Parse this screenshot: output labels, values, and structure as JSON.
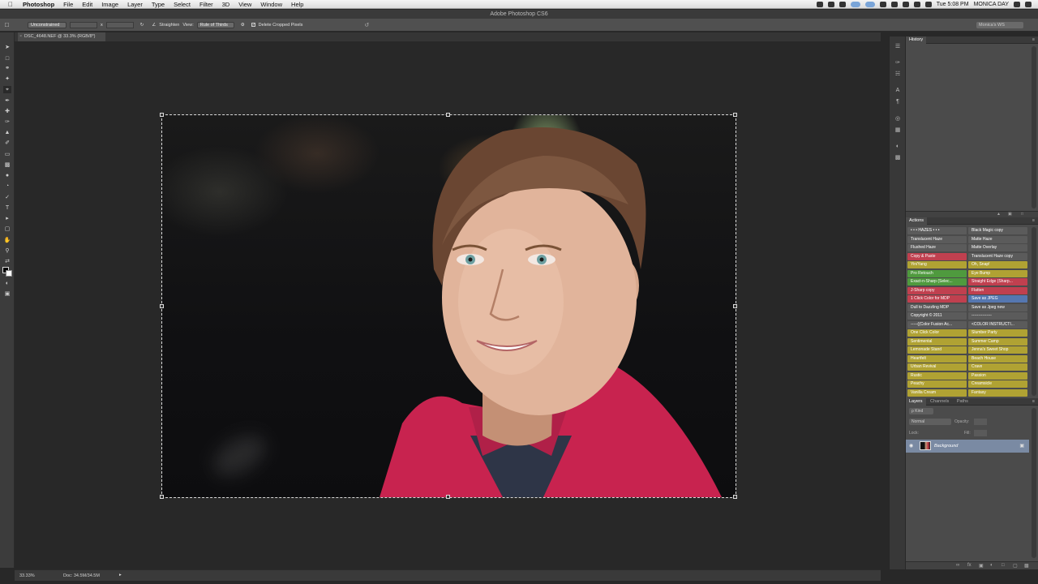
{
  "menubar": {
    "app_name": "Photoshop",
    "items": [
      "File",
      "Edit",
      "Image",
      "Layer",
      "Type",
      "Select",
      "Filter",
      "3D",
      "View",
      "Window",
      "Help"
    ],
    "time": "Tue 5:08 PM",
    "user": "MONICA DAY"
  },
  "window": {
    "title": "Adobe Photoshop CS6"
  },
  "options_bar": {
    "ratio": "Unconstrained",
    "x_label": "x",
    "straighten_label": "Straighten",
    "view_label": "View:",
    "overlay": "Rule of Thirds",
    "delete_cropped_label": "Delete Cropped Pixels",
    "workspace": "Monica's WS"
  },
  "document": {
    "tab_title": "DSC_4648.NEF @ 33.3% (RGB/8*)"
  },
  "history": {
    "title": "History"
  },
  "actions": {
    "title": "Actions",
    "left": [
      {
        "label": "• • • HAZES • • •",
        "color": "#5b5b5b"
      },
      {
        "label": "Translucent Haze",
        "color": "#5b5b5b"
      },
      {
        "label": "Flushed Haze",
        "color": "#5b5b5b"
      },
      {
        "label": "Copy & Paste",
        "color": "#c0404f"
      },
      {
        "label": "Yin/Yang",
        "color": "#b0a233"
      },
      {
        "label": "Pro Retouch",
        "color": "#4f9a3e"
      },
      {
        "label": "Exact-n-Sharp (Selec...",
        "color": "#4f9a3e"
      },
      {
        "label": "J-Sharp copy",
        "color": "#c0404f"
      },
      {
        "label": "1 Click Color for MDP",
        "color": "#c0404f"
      },
      {
        "label": "Dull to Dazzling MDP",
        "color": "#5b5b5b"
      },
      {
        "label": "Copyright © 2011",
        "color": "#5b5b5b"
      },
      {
        "label": "-----((Color Fusion Ac...",
        "color": "#5b5b5b"
      },
      {
        "label": "One Click Color",
        "color": "#b0a233"
      },
      {
        "label": "Sentimental",
        "color": "#b0a233"
      },
      {
        "label": "Lemonade Stand",
        "color": "#b0a233"
      },
      {
        "label": "Heartfelt",
        "color": "#b0a233"
      },
      {
        "label": "Urban Revival",
        "color": "#b0a233"
      },
      {
        "label": "Rustic",
        "color": "#b0a233"
      },
      {
        "label": "Peachy",
        "color": "#b0a233"
      },
      {
        "label": "Vanilla Cream",
        "color": "#b0a233"
      }
    ],
    "right": [
      {
        "label": "Black Magic copy",
        "color": "#5b5b5b"
      },
      {
        "label": "Matte Haze",
        "color": "#5b5b5b"
      },
      {
        "label": "Matte Overlay",
        "color": "#5b5b5b"
      },
      {
        "label": "Translucent Haze copy",
        "color": "#5b5b5b"
      },
      {
        "label": "Oh, Snap!",
        "color": "#b0a233"
      },
      {
        "label": "Eye Bump",
        "color": "#b0a233"
      },
      {
        "label": "Straight Edge (Sharp...",
        "color": "#c0404f"
      },
      {
        "label": "Flatten",
        "color": "#c0404f"
      },
      {
        "label": "Save as JPEG",
        "color": "#5577b0"
      },
      {
        "label": "Save as Jpeg new",
        "color": "#5b5b5b"
      },
      {
        "label": "---------------",
        "color": "#5b5b5b"
      },
      {
        "label": "<COLOR INSTRUCTI...",
        "color": "#5b5b5b"
      },
      {
        "label": "Slumber Party",
        "color": "#b0a233"
      },
      {
        "label": "Summer Camp",
        "color": "#b0a233"
      },
      {
        "label": "Jenna's Sweet Shop",
        "color": "#b0a233"
      },
      {
        "label": "Beach House",
        "color": "#b0a233"
      },
      {
        "label": "Crave",
        "color": "#b0a233"
      },
      {
        "label": "Passion",
        "color": "#b0a233"
      },
      {
        "label": "Creamsicle",
        "color": "#b0a233"
      },
      {
        "label": "Fantasy",
        "color": "#b0a233"
      }
    ]
  },
  "layers": {
    "tabs": [
      "Layers",
      "Channels",
      "Paths"
    ],
    "kind": "ρ Kind",
    "blend_mode": "Normal",
    "opacity_label": "Opacity:",
    "lock_label": "Lock:",
    "fill_label": "Fill:",
    "layer_name": "Background"
  },
  "status_bar": {
    "zoom": "33.33%",
    "doc_size": "Doc: 34.5M/34.5M"
  }
}
